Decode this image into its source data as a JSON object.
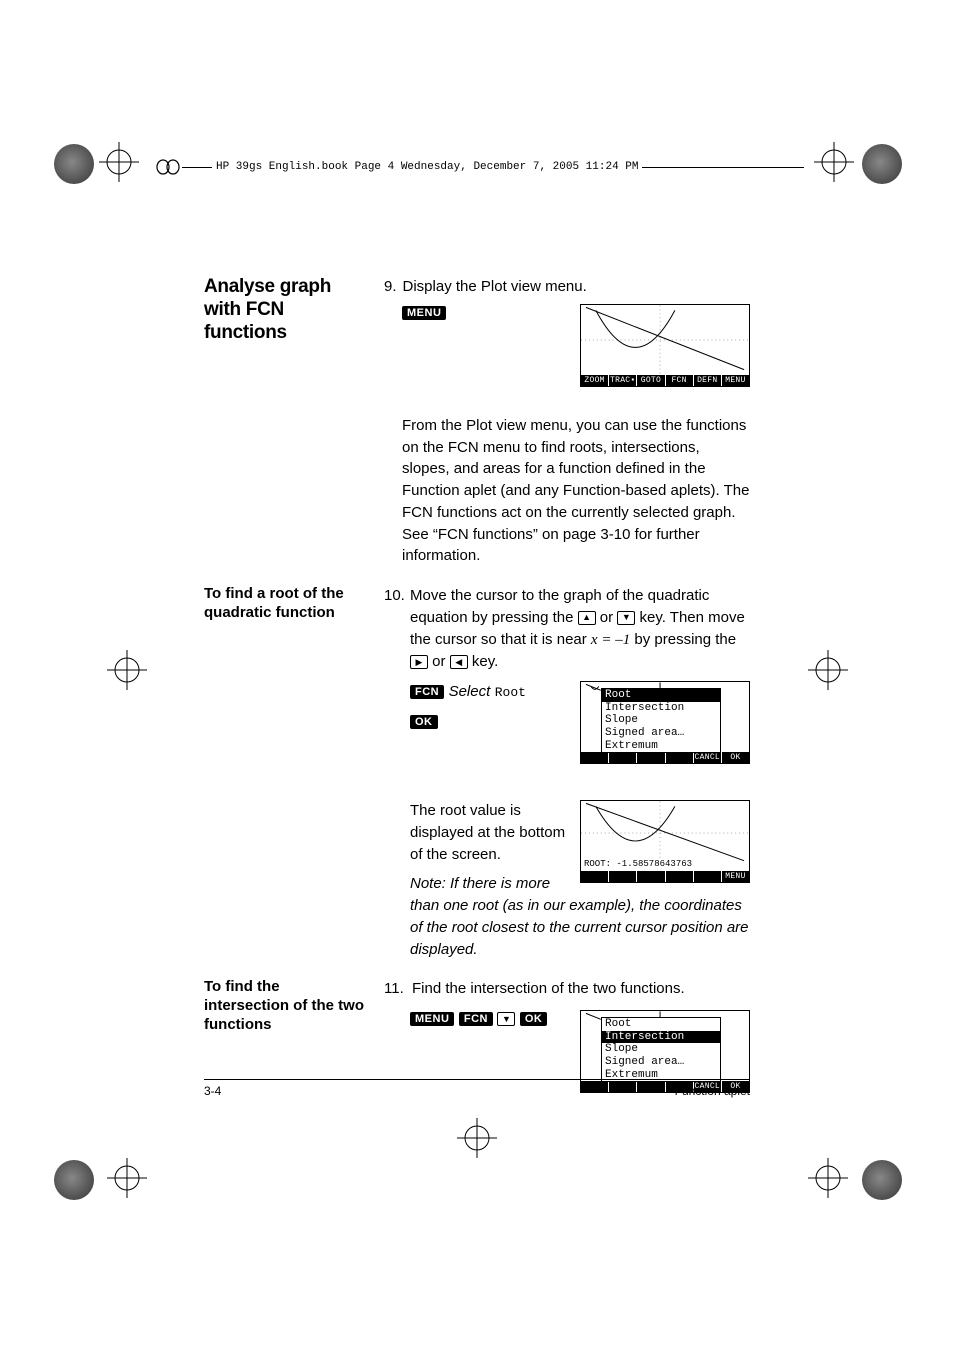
{
  "header": {
    "text": "HP 39gs English.book  Page 4  Wednesday, December 7, 2005  11:24 PM"
  },
  "sections": {
    "analyse": {
      "heading": "Analyse graph with FCN functions",
      "step_num": "9.",
      "step_text": "Display the Plot view menu.",
      "key_menu": "MENU",
      "para": "From the Plot view menu, you can use the functions on the FCN menu to find roots, intersections, slopes, and areas for a function defined in the Function aplet (and any Function-based aplets). The FCN functions act on the currently selected graph. See “FCN functions” on page 3-10 for further information.",
      "screen_softkeys": [
        "ZOOM",
        "TRAC▪",
        "GOTO",
        "FCN",
        "DEFN",
        "MENU"
      ]
    },
    "root": {
      "heading": "To find a root of the quadratic function",
      "step_num": "10.",
      "step_text_a": "Move the cursor to the graph of the quadratic equation by pressing the ",
      "key_up_name": "up-arrow",
      "or1": " or ",
      "key_dn_name": "down-arrow",
      "step_text_b": " key. Then move the cursor so that it is near ",
      "eqn": "x = –1",
      "step_text_c": " by pressing the ",
      "key_right_name": "right-arrow",
      "or2": " or ",
      "key_left_name": "left-arrow",
      "step_text_d": " key.",
      "key_fcn": "FCN",
      "select_word": "Select",
      "select_item": "Root",
      "key_ok": "OK",
      "menu_items": [
        "Root",
        "Intersection",
        "Slope",
        "Signed area…",
        "Extremum"
      ],
      "menu_selected_index": 0,
      "screen1_softkeys": [
        "",
        "",
        "",
        "",
        "CANCL",
        "OK"
      ],
      "para2a": "The root value is displayed at the bottom of the screen.",
      "para2b": "Note: If there is more than one root (as in our example), the coordinates of the root closest to the current cursor position are displayed.",
      "root_label": "ROOT: -1.58578643763",
      "screen2_softkeys": [
        "",
        "",
        "",
        "",
        "",
        "MENU"
      ]
    },
    "intersect": {
      "heading": "To find the intersection of the two functions",
      "step_num": "11.",
      "step_text": "Find the intersection of the two functions.",
      "keys": [
        "MENU",
        "FCN"
      ],
      "hardkey_name": "down-arrow",
      "key_ok": "OK",
      "menu_items": [
        "Root",
        "Intersection",
        "Slope",
        "Signed area…",
        "Extremum"
      ],
      "menu_selected_index": 1,
      "screen_softkeys": [
        "",
        "",
        "",
        "",
        "CANCL",
        "OK"
      ]
    }
  },
  "footer": {
    "left": "3-4",
    "right": "Function aplet"
  }
}
